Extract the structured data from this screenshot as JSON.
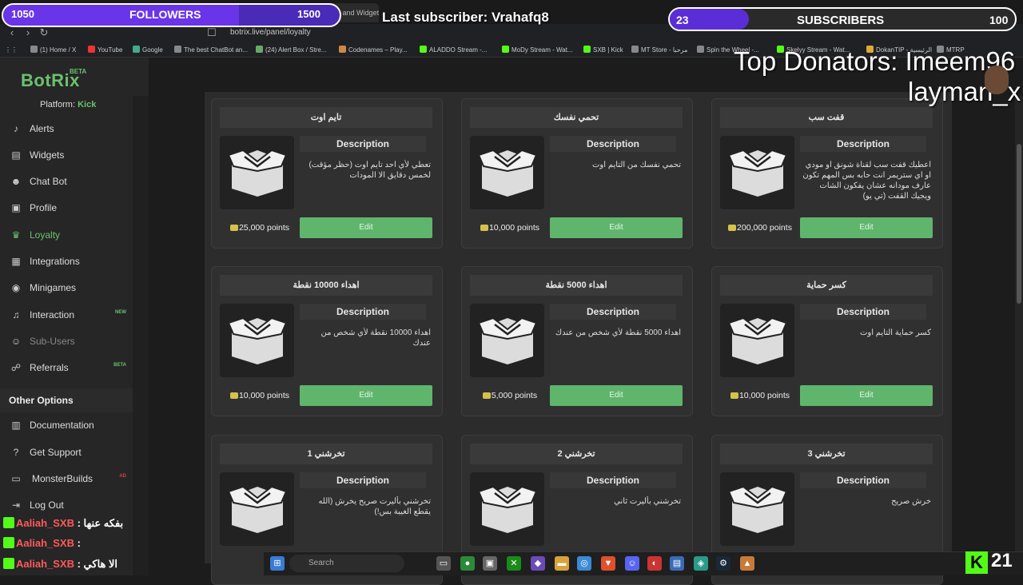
{
  "browser": {
    "tab_title": "The best ChatBot and Widgets fo",
    "url": "botrix.live/panel/loyalty",
    "bookmarks": [
      "(1) Home / X",
      "YouTube",
      "Google",
      "The best ChatBot an...",
      "(24) Alert Box / Stre...",
      "Codenames – Play...",
      "ALADDO Stream -...",
      "MoDy Stream - Wat...",
      "SXB | Kick",
      "MT Store - مرحبا",
      "Spin the Wheel -...",
      "Skelyy Stream - Wat...",
      "DokanTIP - الرئيسية",
      "MTRP"
    ]
  },
  "sidebar": {
    "logo": "BotRix",
    "logo_badge": "BETA",
    "platform_label": "Platform:",
    "platform_value": "Kick",
    "items": [
      {
        "label": "Alerts",
        "icon": "bell-icon"
      },
      {
        "label": "Widgets",
        "icon": "widgets-icon"
      },
      {
        "label": "Chat Bot",
        "icon": "robot-icon"
      },
      {
        "label": "Profile",
        "icon": "profile-card-icon"
      },
      {
        "label": "Loyalty",
        "icon": "trophy-icon"
      },
      {
        "label": "Integrations",
        "icon": "integrations-icon"
      },
      {
        "label": "Minigames",
        "icon": "gamepad-icon"
      },
      {
        "label": "Interaction",
        "icon": "music-note-icon",
        "badge": "NEW"
      },
      {
        "label": "Sub-Users",
        "icon": "users-icon"
      },
      {
        "label": "Referrals",
        "icon": "referrals-icon",
        "badge": "BETA"
      }
    ],
    "other_title": "Other Options",
    "other_items": [
      {
        "label": "Documentation",
        "icon": "docs-icon"
      },
      {
        "label": "Get Support",
        "icon": "help-icon"
      },
      {
        "label": "MonsterBuilds",
        "icon": "monitor-icon",
        "badge": "AD"
      },
      {
        "label": "Log Out",
        "icon": "logout-icon"
      }
    ]
  },
  "loyalty": {
    "desc_header": "Description",
    "edit_label": "Edit",
    "cards": [
      {
        "title": "تايم اوت",
        "desc": "تعطي لأي احد تايم اوت (حظر مؤقت) لخمس دقايق الا المودات",
        "points": "25,000 points"
      },
      {
        "title": "تحمي نفسك",
        "desc": "تحمي نفسك من التايم اوت",
        "points": "10,000 points"
      },
      {
        "title": "قفت سب",
        "desc": "اعطيك قفت سب لقناة شونق او مودي او اي ستريمر انت حابه بس المهم تكون عارف مودانه عشان يفكون الشات ويجيك القفت (تي يو)",
        "points": "200,000 points"
      },
      {
        "title": "اهداء 10000 نقطة",
        "desc": "اهداء 10000 نقطة لأي شخص من عندك",
        "points": "10,000 points"
      },
      {
        "title": "اهداء 5000 نقطة",
        "desc": "اهداء 5000 نقطة لأي شخص من عندك",
        "points": "5,000 points"
      },
      {
        "title": "كسر حماية",
        "desc": "كسر حماية التايم اوت",
        "points": "10,000 points"
      },
      {
        "title": "تخرشني 1",
        "desc": "تخرشني بأليرت صريح يخرش (الله يقطع الغيبة بس!)",
        "points": ""
      },
      {
        "title": "تخرشني 2",
        "desc": "تخرشني بأليرت ثاني",
        "points": ""
      },
      {
        "title": "تخرشني 3",
        "desc": "خرش صريح",
        "points": ""
      }
    ]
  },
  "overlay": {
    "followers_count": "1050",
    "followers_label": "FOLLOWERS",
    "followers_goal": "1500",
    "followers_progress": 0.7,
    "last_subscriber": "Last subscriber: Vrahafq8",
    "subs_count": "23",
    "subs_label": "SUBSCRIBERS",
    "subs_goal": "100",
    "subs_progress": 0.23,
    "top_donators_line1": "Top Donators: Imeem96",
    "top_donators_line2": "layman_x",
    "chat": [
      {
        "user": "Aaliah_SXB",
        "msg": "بفكه عنها"
      },
      {
        "user": "Aaliah_SXB",
        "msg": ""
      },
      {
        "user": "Aaliah_SXB",
        "msg": "الا هاكي"
      }
    ],
    "kick_viewers": "21"
  },
  "taskbar": {
    "search_placeholder": "Search"
  },
  "colors": {
    "accent": "#6cc06f",
    "button": "#5fb56c",
    "overlay_bar": "#5b2dd6",
    "kick_green": "#53fc18"
  }
}
